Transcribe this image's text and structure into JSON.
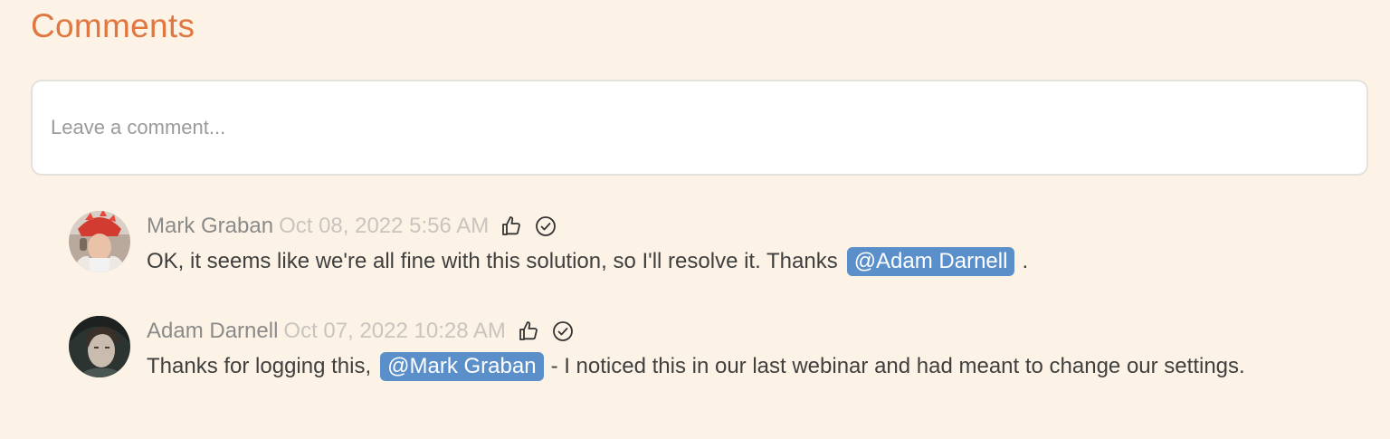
{
  "heading": "Comments",
  "input": {
    "placeholder": "Leave a comment..."
  },
  "comments": [
    {
      "author": "Mark Graban",
      "time": "Oct 08, 2022 5:56 AM",
      "text_before": "OK, it seems like we're all fine with this solution, so I'll resolve it. Thanks",
      "mention": "@Adam Darnell",
      "text_after": ".",
      "icons": [
        "thumbs-up-icon",
        "check-circle-icon"
      ]
    },
    {
      "author": "Adam Darnell",
      "time": "Oct 07, 2022 10:28 AM",
      "text_before": "Thanks for logging this,",
      "mention": "@Mark Graban",
      "text_after": "- I noticed this in our last webinar and had meant to change our settings.",
      "icons": [
        "thumbs-up-icon",
        "check-circle-icon"
      ]
    }
  ],
  "colors": {
    "background": "#fcf3e6",
    "heading": "#e0773f",
    "mention_bg": "#5a8fc9",
    "author": "#8a8a8a",
    "timestamp": "#c9c4bd",
    "text": "#3f3f3f"
  }
}
